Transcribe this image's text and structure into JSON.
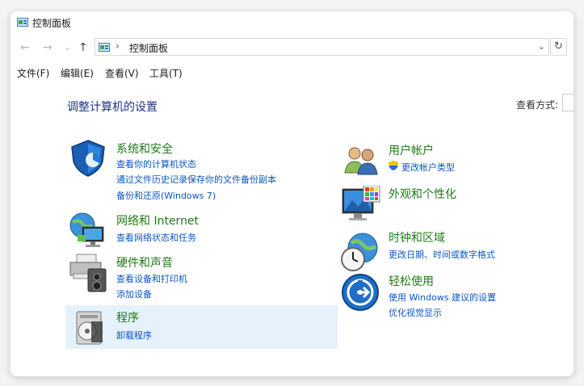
{
  "window": {
    "title": "控制面板"
  },
  "nav": {
    "back": "←",
    "forward": "→",
    "recent": "⌄",
    "up": "↑"
  },
  "address": {
    "separator": "›",
    "path": "控制面板",
    "dropdown": "⌄",
    "refresh": "↻"
  },
  "menu": [
    "文件(F)",
    "编辑(E)",
    "查看(V)",
    "工具(T)"
  ],
  "heading": "调整计算机的设置",
  "view_by": {
    "label": "查看方式:"
  },
  "left_categories": [
    {
      "title": "系统和安全",
      "links": [
        "查看你的计算机状态",
        "通过文件历史记录保存你的文件备份副本",
        "备份和还原(Windows 7)"
      ]
    },
    {
      "title": "网络和 Internet",
      "links": [
        "查看网络状态和任务"
      ]
    },
    {
      "title": "硬件和声音",
      "links": [
        "查看设备和打印机",
        "添加设备"
      ]
    },
    {
      "title": "程序",
      "links": [
        "卸载程序"
      ]
    }
  ],
  "right_categories": [
    {
      "title": "用户帐户",
      "links": [
        "更改帐户类型"
      ]
    },
    {
      "title": "外观和个性化",
      "links": []
    },
    {
      "title": "时钟和区域",
      "links": [
        "更改日期、时间或数字格式"
      ]
    },
    {
      "title": "轻松使用",
      "links": [
        "使用 Windows 建议的设置",
        "优化视觉显示"
      ]
    }
  ],
  "colors": {
    "category_title": "#1e7a16",
    "link": "#0b56c3",
    "heading": "#1e3287",
    "highlight": "#e5f1fb"
  }
}
